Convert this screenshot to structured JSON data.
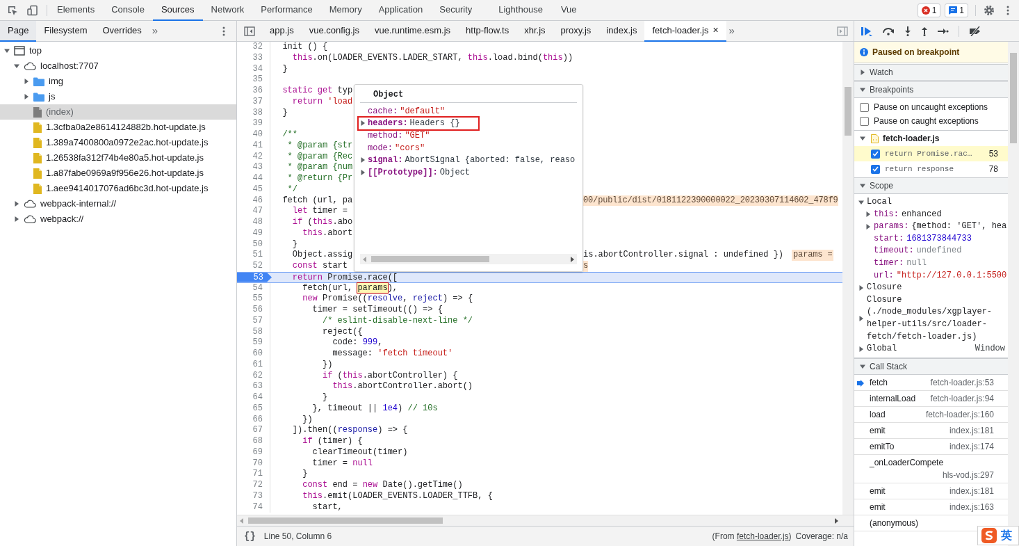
{
  "main_tabs": [
    {
      "label": "Elements",
      "selected": false
    },
    {
      "label": "Console",
      "selected": false
    },
    {
      "label": "Sources",
      "selected": true
    },
    {
      "label": "Network",
      "selected": false
    },
    {
      "label": "Performance",
      "selected": false
    },
    {
      "label": "Memory",
      "selected": false
    },
    {
      "label": "Application",
      "selected": false
    },
    {
      "label": "Security",
      "selected": false
    },
    {
      "label": "Lighthouse",
      "selected": false
    },
    {
      "label": "Vue",
      "selected": false
    }
  ],
  "toolbar_badges": [
    {
      "kind": "error",
      "count": "1"
    },
    {
      "kind": "message",
      "count": "1"
    }
  ],
  "navigator": {
    "tabs": [
      {
        "label": "Page",
        "selected": true
      },
      {
        "label": "Filesystem",
        "selected": false
      },
      {
        "label": "Overrides",
        "selected": false
      }
    ],
    "more": "»",
    "tree": [
      {
        "label": "top",
        "kind": "frame",
        "expanded": true,
        "selected": false,
        "children": [
          {
            "label": "localhost:7707",
            "kind": "origin",
            "expanded": true,
            "selected": false,
            "children": [
              {
                "label": "img",
                "kind": "folder",
                "expanded": false,
                "selected": false
              },
              {
                "label": "js",
                "kind": "folder",
                "expanded": false,
                "selected": false
              },
              {
                "label": "(index)",
                "kind": "document",
                "selected": true
              },
              {
                "label": "1.3cfba0a2e8614124882b.hot-update.js",
                "kind": "script",
                "selected": false
              },
              {
                "label": "1.389a7400800a0972e2ac.hot-update.js",
                "kind": "script",
                "selected": false
              },
              {
                "label": "1.26538fa312f74b4e80a5.hot-update.js",
                "kind": "script",
                "selected": false
              },
              {
                "label": "1.a87fabe0969a9f956e26.hot-update.js",
                "kind": "script",
                "selected": false
              },
              {
                "label": "1.aee9414017076ad6bc3d.hot-update.js",
                "kind": "script",
                "selected": false
              }
            ]
          },
          {
            "label": "webpack-internal://",
            "kind": "origin",
            "expanded": false,
            "selected": false
          },
          {
            "label": "webpack://",
            "kind": "origin",
            "expanded": false,
            "selected": false
          }
        ]
      }
    ]
  },
  "editor": {
    "tabs": [
      {
        "label": "app.js",
        "selected": false
      },
      {
        "label": "vue.config.js",
        "selected": false
      },
      {
        "label": "vue.runtime.esm.js",
        "selected": false
      },
      {
        "label": "http-flow.ts",
        "selected": false
      },
      {
        "label": "xhr.js",
        "selected": false
      },
      {
        "label": "proxy.js",
        "selected": false
      },
      {
        "label": "index.js",
        "selected": false
      },
      {
        "label": "fetch-loader.js",
        "selected": true,
        "close": "×"
      }
    ],
    "more": "»",
    "lines": [
      {
        "n": "32",
        "breakpoint": false,
        "parts": [
          {
            "text": "  init () {",
            "kind": "plain"
          }
        ]
      },
      {
        "n": "33",
        "breakpoint": false,
        "parts": [
          {
            "text": "    this",
            "kind": "keyword"
          },
          {
            "text": ".on(LOADER_EVENTS.LADER_START, ",
            "kind": "plain"
          },
          {
            "text": "this",
            "kind": "keyword"
          },
          {
            "text": ".load.bind(",
            "kind": "plain"
          },
          {
            "text": "this",
            "kind": "keyword"
          },
          {
            "text": "))",
            "kind": "plain"
          }
        ]
      },
      {
        "n": "34",
        "breakpoint": false,
        "parts": [
          {
            "text": "  }",
            "kind": "plain"
          }
        ]
      },
      {
        "n": "35",
        "breakpoint": false
      },
      {
        "n": "36",
        "breakpoint": false,
        "parts": [
          {
            "text": "  static get",
            "kind": "keyword"
          },
          {
            "text": " typ",
            "kind": "plain"
          }
        ]
      },
      {
        "n": "37",
        "breakpoint": false,
        "parts": [
          {
            "text": "    return",
            "kind": "keyword"
          },
          {
            "text": " 'load",
            "kind": "string"
          }
        ]
      },
      {
        "n": "38",
        "breakpoint": false,
        "parts": [
          {
            "text": "  }",
            "kind": "plain"
          }
        ]
      },
      {
        "n": "39",
        "breakpoint": false
      },
      {
        "n": "40",
        "breakpoint": false,
        "parts": [
          {
            "text": "  /**",
            "kind": "comment"
          }
        ]
      },
      {
        "n": "41",
        "breakpoint": false,
        "parts": [
          {
            "text": "   * @param {str",
            "kind": "comment"
          }
        ]
      },
      {
        "n": "42",
        "breakpoint": false,
        "parts": [
          {
            "text": "   * @param {Rec",
            "kind": "comment"
          }
        ]
      },
      {
        "n": "43",
        "breakpoint": false,
        "parts": [
          {
            "text": "   * @param {num",
            "kind": "comment"
          }
        ]
      },
      {
        "n": "44",
        "breakpoint": false,
        "parts": [
          {
            "text": "   * @return {Pr",
            "kind": "comment"
          }
        ]
      },
      {
        "n": "45",
        "breakpoint": false,
        "parts": [
          {
            "text": "   */",
            "kind": "comment"
          }
        ]
      },
      {
        "n": "46",
        "breakpoint": false,
        "parts": [
          {
            "text": "  fetch (url, pa",
            "kind": "plain"
          }
        ],
        "after_popup": [
          {
            "text": "00/public/dist/0181122390000022_20230307114602_478f9",
            "kind": "value"
          }
        ]
      },
      {
        "n": "47",
        "breakpoint": false,
        "parts": [
          {
            "text": "    let",
            "kind": "keyword"
          },
          {
            "text": " timer =",
            "kind": "plain"
          }
        ]
      },
      {
        "n": "48",
        "breakpoint": false,
        "parts": [
          {
            "text": "    if",
            "kind": "keyword"
          },
          {
            "text": " (",
            "kind": "plain"
          },
          {
            "text": "this",
            "kind": "keyword"
          },
          {
            "text": ".abo",
            "kind": "plain"
          }
        ]
      },
      {
        "n": "49",
        "breakpoint": false,
        "parts": [
          {
            "text": "      this",
            "kind": "keyword"
          },
          {
            "text": ".abort",
            "kind": "plain"
          }
        ]
      },
      {
        "n": "50",
        "breakpoint": false,
        "parts": [
          {
            "text": "    }",
            "kind": "plain"
          }
        ]
      },
      {
        "n": "51",
        "breakpoint": false,
        "parts": [
          {
            "text": "    Object.assig",
            "kind": "plain"
          }
        ],
        "after_popup": [
          {
            "text": "is.abortController.signal : undefined })",
            "kind": "plain"
          },
          {
            "text": "params =",
            "kind": "value"
          }
        ]
      },
      {
        "n": "52",
        "breakpoint": false,
        "parts": [
          {
            "text": "    const",
            "kind": "keyword"
          },
          {
            "text": " start",
            "kind": "plain"
          }
        ],
        "after_popup": [
          {
            "text": "s",
            "kind": "value"
          }
        ]
      },
      {
        "n": "53",
        "breakpoint": true,
        "parts": [
          {
            "text": "    return",
            "kind": "keyword"
          },
          {
            "text": " Promise.race([",
            "kind": "plain"
          }
        ]
      },
      {
        "n": "54",
        "breakpoint": false,
        "parts": [
          {
            "text": "      fetch(url, ",
            "kind": "plain"
          },
          {
            "text": "params",
            "kind": "match"
          },
          {
            "text": "),",
            "kind": "plain"
          }
        ]
      },
      {
        "n": "55",
        "breakpoint": false,
        "parts": [
          {
            "text": "      new",
            "kind": "keyword"
          },
          {
            "text": " Promise((",
            "kind": "plain"
          },
          {
            "text": "resolve",
            "kind": "variable"
          },
          {
            "text": ", ",
            "kind": "plain"
          },
          {
            "text": "reject",
            "kind": "variable"
          },
          {
            "text": ") => {",
            "kind": "plain"
          }
        ]
      },
      {
        "n": "56",
        "breakpoint": false,
        "parts": [
          {
            "text": "        timer = setTimeout(() => {",
            "kind": "plain"
          }
        ]
      },
      {
        "n": "57",
        "breakpoint": false,
        "parts": [
          {
            "text": "          /* eslint-disable-next-line */",
            "kind": "comment"
          }
        ]
      },
      {
        "n": "58",
        "breakpoint": false,
        "parts": [
          {
            "text": "          reject({",
            "kind": "plain"
          }
        ]
      },
      {
        "n": "59",
        "breakpoint": false,
        "parts": [
          {
            "text": "            code: ",
            "kind": "plain"
          },
          {
            "text": "999",
            "kind": "number"
          },
          {
            "text": ",",
            "kind": "plain"
          }
        ]
      },
      {
        "n": "60",
        "breakpoint": false,
        "parts": [
          {
            "text": "            message: ",
            "kind": "plain"
          },
          {
            "text": "'fetch timeout'",
            "kind": "string"
          }
        ]
      },
      {
        "n": "61",
        "breakpoint": false,
        "parts": [
          {
            "text": "          })",
            "kind": "plain"
          }
        ]
      },
      {
        "n": "62",
        "breakpoint": false,
        "parts": [
          {
            "text": "          if",
            "kind": "keyword"
          },
          {
            "text": " (",
            "kind": "plain"
          },
          {
            "text": "this",
            "kind": "keyword"
          },
          {
            "text": ".abortController) {",
            "kind": "plain"
          }
        ]
      },
      {
        "n": "63",
        "breakpoint": false,
        "parts": [
          {
            "text": "            this",
            "kind": "keyword"
          },
          {
            "text": ".abortController.abort()",
            "kind": "plain"
          }
        ]
      },
      {
        "n": "64",
        "breakpoint": false,
        "parts": [
          {
            "text": "          }",
            "kind": "plain"
          }
        ]
      },
      {
        "n": "65",
        "breakpoint": false,
        "parts": [
          {
            "text": "        }, timeout || ",
            "kind": "plain"
          },
          {
            "text": "1e4",
            "kind": "number"
          },
          {
            "text": ") ",
            "kind": "plain"
          },
          {
            "text": "// 10s",
            "kind": "comment"
          }
        ]
      },
      {
        "n": "66",
        "breakpoint": false,
        "parts": [
          {
            "text": "      })",
            "kind": "plain"
          }
        ]
      },
      {
        "n": "67",
        "breakpoint": false,
        "parts": [
          {
            "text": "    ]).then((",
            "kind": "plain"
          },
          {
            "text": "response",
            "kind": "variable"
          },
          {
            "text": ") => {",
            "kind": "plain"
          }
        ]
      },
      {
        "n": "68",
        "breakpoint": false,
        "parts": [
          {
            "text": "      if",
            "kind": "keyword"
          },
          {
            "text": " (timer) {",
            "kind": "plain"
          }
        ]
      },
      {
        "n": "69",
        "breakpoint": false,
        "parts": [
          {
            "text": "        clearTimeout(timer)",
            "kind": "plain"
          }
        ]
      },
      {
        "n": "70",
        "breakpoint": false,
        "parts": [
          {
            "text": "        timer = ",
            "kind": "plain"
          },
          {
            "text": "null",
            "kind": "keyword"
          }
        ]
      },
      {
        "n": "71",
        "breakpoint": false,
        "parts": [
          {
            "text": "      }",
            "kind": "plain"
          }
        ]
      },
      {
        "n": "72",
        "breakpoint": false,
        "parts": [
          {
            "text": "      const",
            "kind": "keyword"
          },
          {
            "text": " end = ",
            "kind": "plain"
          },
          {
            "text": "new",
            "kind": "keyword"
          },
          {
            "text": " Date().getTime()",
            "kind": "plain"
          }
        ]
      },
      {
        "n": "73",
        "breakpoint": false,
        "parts": [
          {
            "text": "      this",
            "kind": "keyword"
          },
          {
            "text": ".emit(LOADER_EVENTS.LOADER_TTFB, {",
            "kind": "plain"
          }
        ]
      },
      {
        "n": "74",
        "breakpoint": false,
        "parts": [
          {
            "text": "        start,",
            "kind": "plain"
          }
        ]
      }
    ],
    "popup": {
      "title": "Object",
      "properties": [
        {
          "name": "cache:",
          "value": "\"default\"",
          "kind": "string",
          "expandable": false,
          "highlighted": false
        },
        {
          "name": "headers:",
          "value": "Headers {}",
          "kind": "object",
          "expandable": true,
          "highlighted": true
        },
        {
          "name": "method:",
          "value": "\"GET\"",
          "kind": "string",
          "expandable": false,
          "highlighted": false
        },
        {
          "name": "mode:",
          "value": "\"cors\"",
          "kind": "string",
          "expandable": false,
          "highlighted": false
        },
        {
          "name": "signal:",
          "value": "AbortSignal {aborted: false, reaso",
          "kind": "object",
          "expandable": true,
          "highlighted": false
        },
        {
          "name": "[[Prototype]]:",
          "value": "Object",
          "kind": "object",
          "expandable": true,
          "highlighted": false
        }
      ]
    },
    "status_bar": {
      "format_button": "{}",
      "position": "Line 50, Column 6",
      "source_prefix": "(From",
      "source_link": "fetch-loader.js",
      "source_suffix": ")",
      "coverage": "Coverage: n/a"
    }
  },
  "debugger": {
    "paused_banner": "Paused on breakpoint",
    "watch": {
      "title": "Watch",
      "expanded": false
    },
    "breakpoints": {
      "title": "Breakpoints",
      "expanded": true,
      "options": [
        {
          "label": "Pause on uncaught exceptions",
          "checked": false
        },
        {
          "label": "Pause on caught exceptions",
          "checked": false
        }
      ],
      "files": [
        {
          "name": "fetch-loader.js",
          "expanded": true,
          "items": [
            {
              "code": "return Promise.rac…",
              "line": "53",
              "checked": true,
              "selected": true
            },
            {
              "code": "return response",
              "line": "78",
              "checked": true,
              "selected": false
            }
          ]
        }
      ]
    },
    "scope": {
      "title": "Scope",
      "expanded": true,
      "items": [
        {
          "label": "Local",
          "expanded": true,
          "children": [
            {
              "name": "this:",
              "value": "enhanced",
              "kind": "object",
              "expandable": true
            },
            {
              "name": "params:",
              "value": "{method: 'GET', hea",
              "kind": "object",
              "expandable": true
            },
            {
              "name": "start:",
              "value": "1681373844733",
              "kind": "number",
              "expandable": false
            },
            {
              "name": "timeout:",
              "value": "undefined",
              "kind": "empty",
              "expandable": false
            },
            {
              "name": "timer:",
              "value": "null",
              "kind": "empty",
              "expandable": false
            },
            {
              "name": "url:",
              "value": "\"http://127.0.0.1:5500",
              "kind": "string",
              "expandable": false
            }
          ]
        },
        {
          "label": "Closure",
          "expanded": false
        },
        {
          "label": "Closure (./node_modules/xgplayer-helper-utils/src/loader-fetch/fetch-loader.js)",
          "expanded": false
        },
        {
          "label": "Global",
          "value": "Window",
          "expanded": false
        }
      ]
    },
    "call_stack": {
      "title": "Call Stack",
      "expanded": true,
      "frames": [
        {
          "name": "fetch",
          "location": "fetch-loader.js:53",
          "selected": true
        },
        {
          "name": "internalLoad",
          "location": "fetch-loader.js:94",
          "selected": false
        },
        {
          "name": "load",
          "location": "fetch-loader.js:160",
          "selected": false
        },
        {
          "name": "emit",
          "location": "index.js:181",
          "selected": false
        },
        {
          "name": "emitTo",
          "location": "index.js:174",
          "selected": false
        },
        {
          "name": "_onLoaderCompete",
          "location": "hls-vod.js:297",
          "selected": false
        },
        {
          "name": "emit",
          "location": "index.js:181",
          "selected": false
        },
        {
          "name": "emit",
          "location": "index.js:163",
          "selected": false
        },
        {
          "name": "(anonymous)",
          "selected": false
        }
      ]
    }
  },
  "ime_widget": {
    "label": "英"
  }
}
